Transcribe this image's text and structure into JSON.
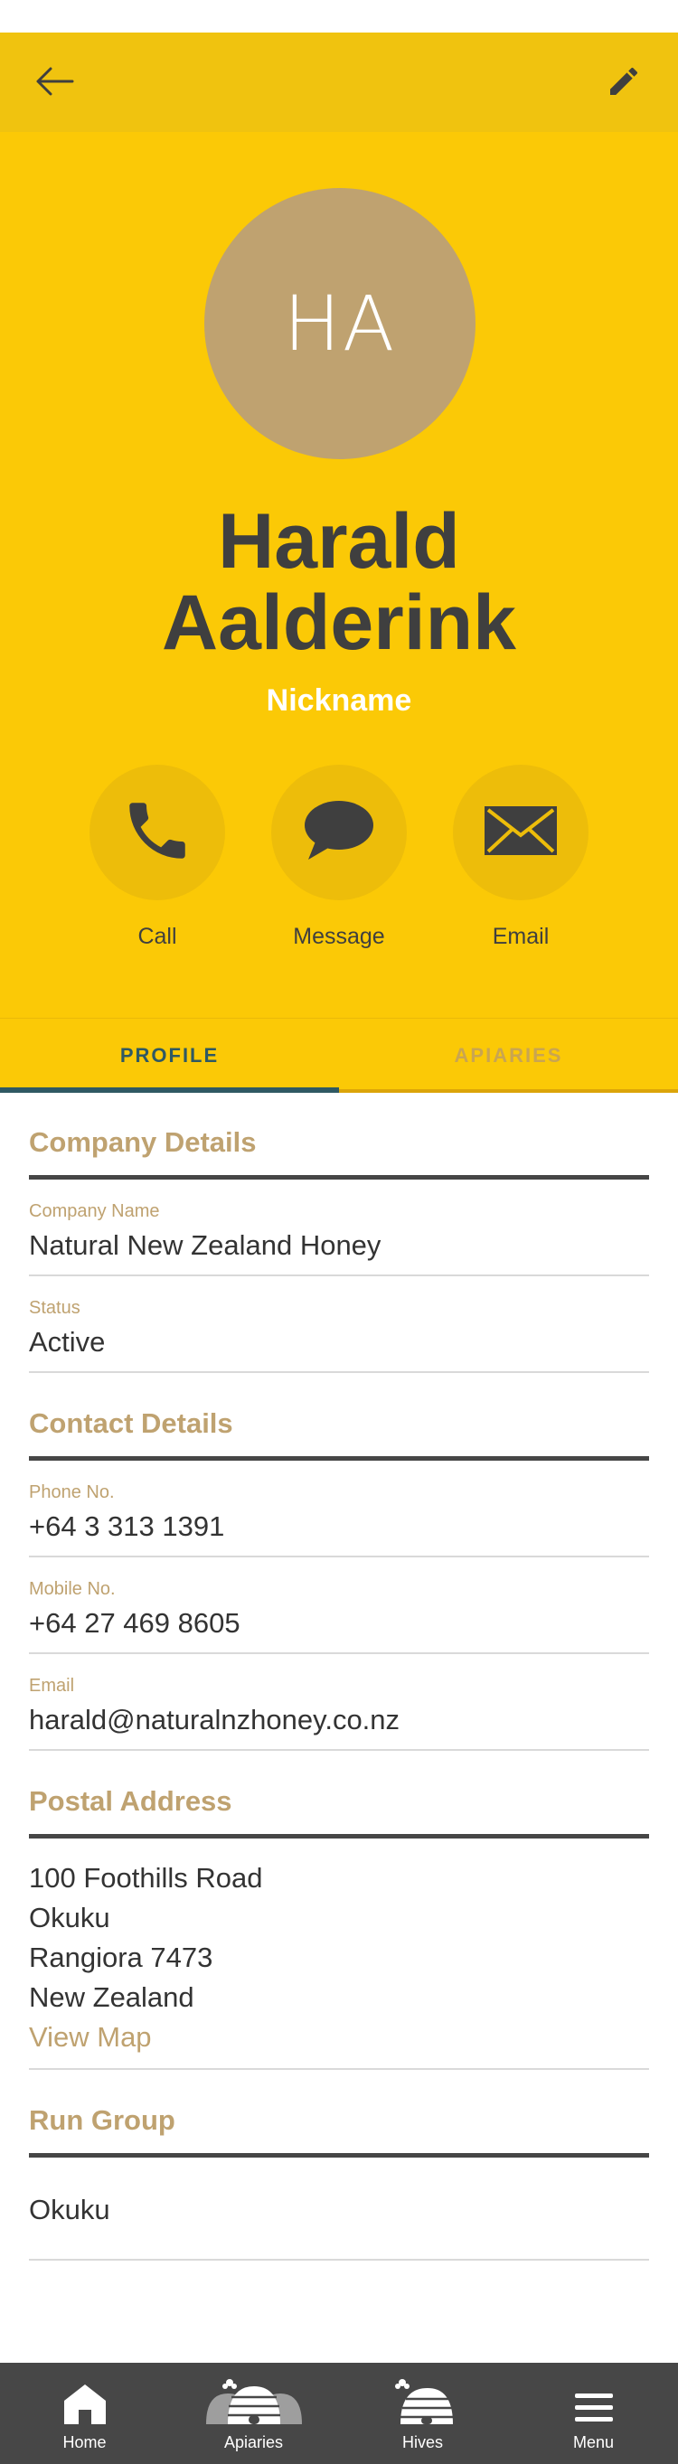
{
  "header": {
    "back_icon": "arrow-left-icon",
    "edit_icon": "pencil-icon"
  },
  "profile": {
    "initials": "HA",
    "name": "Harald Aalderink",
    "nickname": "Nickname"
  },
  "actions": [
    {
      "label": "Call",
      "icon": "phone-icon"
    },
    {
      "label": "Message",
      "icon": "chat-bubble-icon"
    },
    {
      "label": "Email",
      "icon": "envelope-icon"
    }
  ],
  "tabs": [
    {
      "label": "PROFILE",
      "active": true
    },
    {
      "label": "APIARIES",
      "active": false
    }
  ],
  "company": {
    "title": "Company Details",
    "company_name_label": "Company Name",
    "company_name": "Natural New Zealand Honey",
    "status_label": "Status",
    "status": "Active"
  },
  "contact": {
    "title": "Contact Details",
    "phone_label": "Phone No.",
    "phone": "+64 3 313 1391",
    "mobile_label": "Mobile No.",
    "mobile": "+64 27 469 8605",
    "email_label": "Email",
    "email": "harald@naturalnzhoney.co.nz"
  },
  "postal": {
    "title": "Postal Address",
    "line1": "100 Foothills Road",
    "line2": "Okuku",
    "line3": "Rangiora 7473",
    "line4": "New Zealand",
    "view_map": "View Map"
  },
  "run_group": {
    "title": "Run Group",
    "value": "Okuku"
  },
  "bottom_nav": [
    {
      "label": "Home",
      "icon": "home-icon"
    },
    {
      "label": "Apiaries",
      "icon": "apiary-hives-icon"
    },
    {
      "label": "Hives",
      "icon": "beehive-icon"
    },
    {
      "label": "Menu",
      "icon": "hamburger-menu-icon"
    }
  ],
  "colors": {
    "brand_yellow": "#fbc906",
    "topbar_yellow": "#f0c30f",
    "accent_gold": "#bfa270",
    "tab_active": "#2f5963",
    "dark_text": "#3f3f3f",
    "nav_bg": "#474747"
  }
}
